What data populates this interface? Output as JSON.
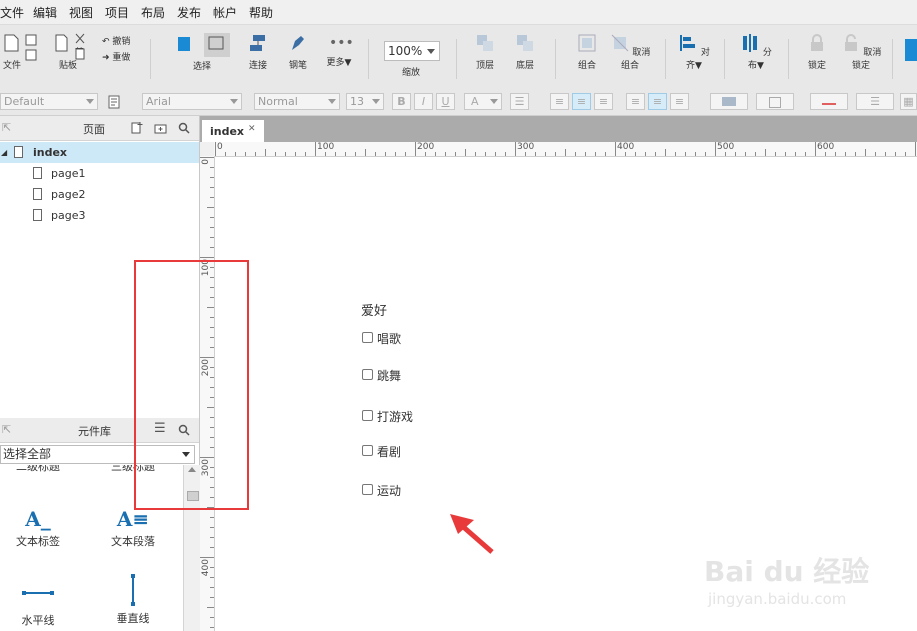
{
  "menu": [
    "文件",
    "编辑",
    "视图",
    "项目",
    "布局",
    "发布",
    "帐户",
    "帮助"
  ],
  "toolbar": {
    "file": "文件",
    "clipboard": "剪贴板",
    "undo": "撤销",
    "redo": "重做",
    "select": "选择",
    "connect": "连接",
    "pen": "钢笔",
    "more": "更多▼",
    "zoom": "100%",
    "zoom_label": "缩放",
    "front": "顶层",
    "back": "底层",
    "group": "组合",
    "ungroup": "取消组合",
    "align": "对齐▼",
    "distribute": "分布▼",
    "lock": "锁定",
    "unlock": "取消锁定"
  },
  "format": {
    "style": "Default",
    "font": "Arial",
    "weight": "Normal",
    "size": "13",
    "bold": "B",
    "italic": "I",
    "underline": "U",
    "font_color": "A"
  },
  "pages_panel": {
    "title": "页面",
    "root": "index",
    "pages": [
      "page1",
      "page2",
      "page3"
    ]
  },
  "library_panel": {
    "title": "元件库",
    "filter": "选择全部",
    "partial_labels": [
      "二级标题",
      "三级标题"
    ],
    "widgets": [
      {
        "label": "文本标签",
        "icon": "text-label-icon"
      },
      {
        "label": "文本段落",
        "icon": "text-paragraph-icon"
      },
      {
        "label": "水平线",
        "icon": "horizontal-line-icon"
      },
      {
        "label": "垂直线",
        "icon": "vertical-line-icon"
      }
    ]
  },
  "tab": {
    "name": "index",
    "close": "✕"
  },
  "ruler": {
    "h_marks": [
      "0",
      "100",
      "200",
      "300",
      "400",
      "500",
      "600"
    ],
    "v_marks": [
      "0",
      "100",
      "200",
      "300",
      "400"
    ]
  },
  "canvas": {
    "group_label": "爱好",
    "options": [
      {
        "label": "唱歌",
        "checked": false
      },
      {
        "label": "跳舞",
        "checked": false
      },
      {
        "label": "打游戏",
        "checked": false
      },
      {
        "label": "看剧",
        "checked": false
      },
      {
        "label": "运动",
        "checked": false
      }
    ]
  },
  "watermark": {
    "brand": "Bai du 经验",
    "url": "jingyan.baidu.com"
  },
  "colors": {
    "highlight_box": "#e83a3a",
    "selected_row": "#cde8f6",
    "accent_blue": "#1a8ad4"
  }
}
